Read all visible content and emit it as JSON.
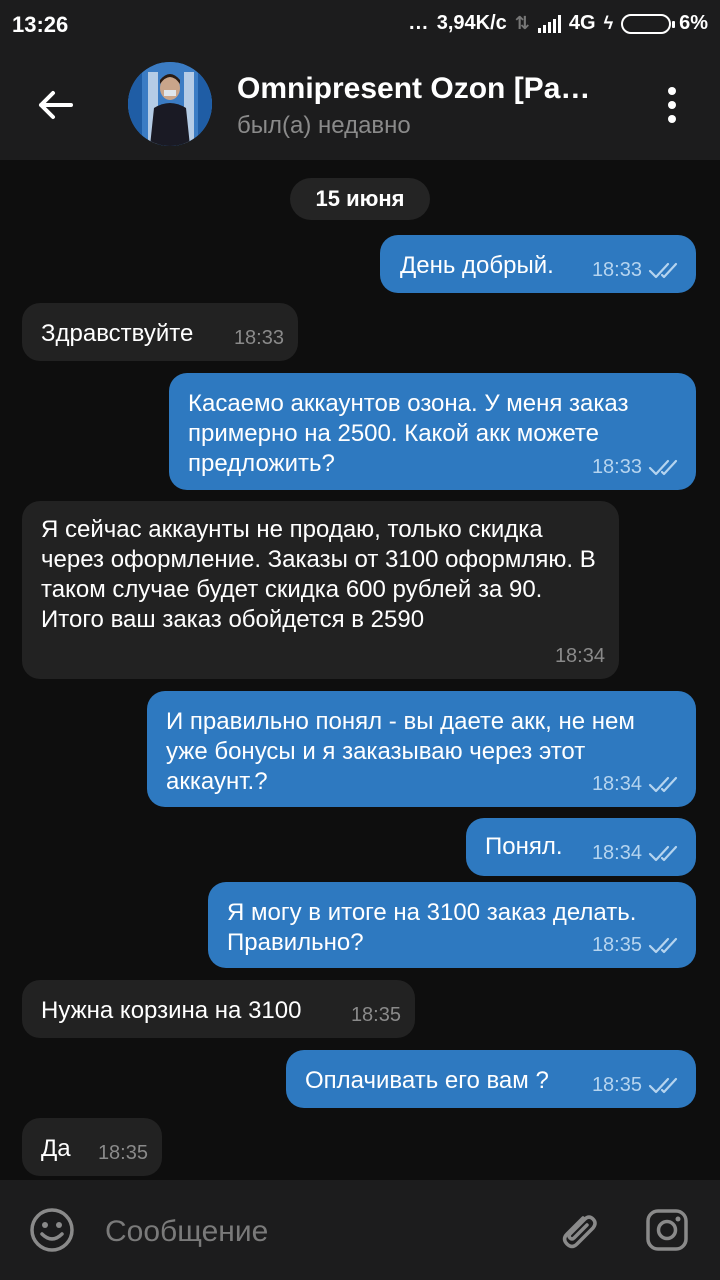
{
  "status_bar": {
    "time": "13:26",
    "dots": "...",
    "speed": "3,94K/c",
    "network": "4G",
    "battery": "6%"
  },
  "header": {
    "title": "Omnipresent Ozon [Pa…",
    "status": "был(а) недавно"
  },
  "chat": {
    "date_label": "15 июня",
    "messages": [
      {
        "dir": "out",
        "text": "День добрый.",
        "time": "18:33"
      },
      {
        "dir": "in",
        "text": "Здравствуйте",
        "time": "18:33"
      },
      {
        "dir": "out",
        "text": "Касаемо аккаунтов озона. У меня заказ примерно на 2500. Какой акк можете предложить?",
        "time": "18:33"
      },
      {
        "dir": "in",
        "text": "Я сейчас аккаунты не продаю, только скидка через оформление. Заказы от 3100 оформляю. В таком случае будет скидка 600 рублей за 90. Итого ваш заказ обойдется в 2590",
        "time": "18:34"
      },
      {
        "dir": "out",
        "text": "И правильно понял - вы даете акк, не нем уже бонусы и я заказываю через этот аккаунт.?",
        "time": "18:34"
      },
      {
        "dir": "out",
        "text": "Понял.",
        "time": "18:34"
      },
      {
        "dir": "out",
        "text": "Я могу в итоге на 3100 заказ делать. Правильно?",
        "time": "18:35"
      },
      {
        "dir": "in",
        "text": "Нужна корзина на 3100",
        "time": "18:35"
      },
      {
        "dir": "out",
        "text": "Оплачивать его вам ?",
        "time": "18:35"
      },
      {
        "dir": "in",
        "text": "Да",
        "time": "18:35"
      }
    ]
  },
  "composer": {
    "placeholder": "Сообщение"
  },
  "colors": {
    "outgoing_bubble": "#2e79c0",
    "incoming_bubble": "#222222",
    "background": "#0e0e0e",
    "header": "#1c1c1d"
  },
  "icons": [
    "back-arrow-icon",
    "more-menu-icon",
    "emoji-icon",
    "attach-icon",
    "camera-icon",
    "read-double-check-icon"
  ]
}
